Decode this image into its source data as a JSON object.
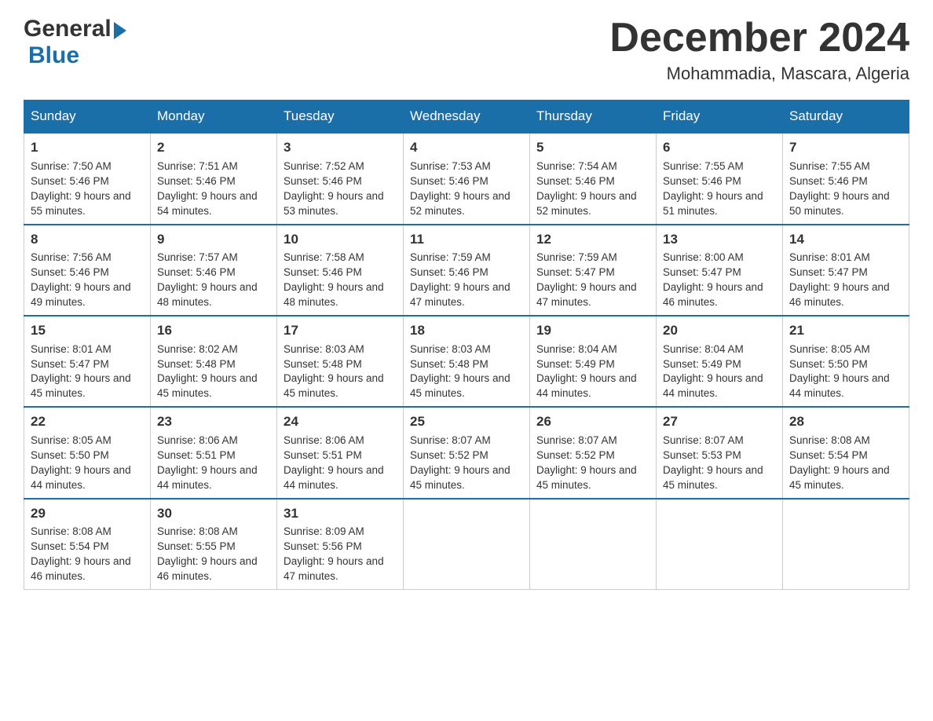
{
  "header": {
    "logo_general": "General",
    "logo_blue": "Blue",
    "month_title": "December 2024",
    "subtitle": "Mohammadia, Mascara, Algeria"
  },
  "days_of_week": [
    "Sunday",
    "Monday",
    "Tuesday",
    "Wednesday",
    "Thursday",
    "Friday",
    "Saturday"
  ],
  "weeks": [
    [
      {
        "day": "1",
        "sunrise": "Sunrise: 7:50 AM",
        "sunset": "Sunset: 5:46 PM",
        "daylight": "Daylight: 9 hours and 55 minutes."
      },
      {
        "day": "2",
        "sunrise": "Sunrise: 7:51 AM",
        "sunset": "Sunset: 5:46 PM",
        "daylight": "Daylight: 9 hours and 54 minutes."
      },
      {
        "day": "3",
        "sunrise": "Sunrise: 7:52 AM",
        "sunset": "Sunset: 5:46 PM",
        "daylight": "Daylight: 9 hours and 53 minutes."
      },
      {
        "day": "4",
        "sunrise": "Sunrise: 7:53 AM",
        "sunset": "Sunset: 5:46 PM",
        "daylight": "Daylight: 9 hours and 52 minutes."
      },
      {
        "day": "5",
        "sunrise": "Sunrise: 7:54 AM",
        "sunset": "Sunset: 5:46 PM",
        "daylight": "Daylight: 9 hours and 52 minutes."
      },
      {
        "day": "6",
        "sunrise": "Sunrise: 7:55 AM",
        "sunset": "Sunset: 5:46 PM",
        "daylight": "Daylight: 9 hours and 51 minutes."
      },
      {
        "day": "7",
        "sunrise": "Sunrise: 7:55 AM",
        "sunset": "Sunset: 5:46 PM",
        "daylight": "Daylight: 9 hours and 50 minutes."
      }
    ],
    [
      {
        "day": "8",
        "sunrise": "Sunrise: 7:56 AM",
        "sunset": "Sunset: 5:46 PM",
        "daylight": "Daylight: 9 hours and 49 minutes."
      },
      {
        "day": "9",
        "sunrise": "Sunrise: 7:57 AM",
        "sunset": "Sunset: 5:46 PM",
        "daylight": "Daylight: 9 hours and 48 minutes."
      },
      {
        "day": "10",
        "sunrise": "Sunrise: 7:58 AM",
        "sunset": "Sunset: 5:46 PM",
        "daylight": "Daylight: 9 hours and 48 minutes."
      },
      {
        "day": "11",
        "sunrise": "Sunrise: 7:59 AM",
        "sunset": "Sunset: 5:46 PM",
        "daylight": "Daylight: 9 hours and 47 minutes."
      },
      {
        "day": "12",
        "sunrise": "Sunrise: 7:59 AM",
        "sunset": "Sunset: 5:47 PM",
        "daylight": "Daylight: 9 hours and 47 minutes."
      },
      {
        "day": "13",
        "sunrise": "Sunrise: 8:00 AM",
        "sunset": "Sunset: 5:47 PM",
        "daylight": "Daylight: 9 hours and 46 minutes."
      },
      {
        "day": "14",
        "sunrise": "Sunrise: 8:01 AM",
        "sunset": "Sunset: 5:47 PM",
        "daylight": "Daylight: 9 hours and 46 minutes."
      }
    ],
    [
      {
        "day": "15",
        "sunrise": "Sunrise: 8:01 AM",
        "sunset": "Sunset: 5:47 PM",
        "daylight": "Daylight: 9 hours and 45 minutes."
      },
      {
        "day": "16",
        "sunrise": "Sunrise: 8:02 AM",
        "sunset": "Sunset: 5:48 PM",
        "daylight": "Daylight: 9 hours and 45 minutes."
      },
      {
        "day": "17",
        "sunrise": "Sunrise: 8:03 AM",
        "sunset": "Sunset: 5:48 PM",
        "daylight": "Daylight: 9 hours and 45 minutes."
      },
      {
        "day": "18",
        "sunrise": "Sunrise: 8:03 AM",
        "sunset": "Sunset: 5:48 PM",
        "daylight": "Daylight: 9 hours and 45 minutes."
      },
      {
        "day": "19",
        "sunrise": "Sunrise: 8:04 AM",
        "sunset": "Sunset: 5:49 PM",
        "daylight": "Daylight: 9 hours and 44 minutes."
      },
      {
        "day": "20",
        "sunrise": "Sunrise: 8:04 AM",
        "sunset": "Sunset: 5:49 PM",
        "daylight": "Daylight: 9 hours and 44 minutes."
      },
      {
        "day": "21",
        "sunrise": "Sunrise: 8:05 AM",
        "sunset": "Sunset: 5:50 PM",
        "daylight": "Daylight: 9 hours and 44 minutes."
      }
    ],
    [
      {
        "day": "22",
        "sunrise": "Sunrise: 8:05 AM",
        "sunset": "Sunset: 5:50 PM",
        "daylight": "Daylight: 9 hours and 44 minutes."
      },
      {
        "day": "23",
        "sunrise": "Sunrise: 8:06 AM",
        "sunset": "Sunset: 5:51 PM",
        "daylight": "Daylight: 9 hours and 44 minutes."
      },
      {
        "day": "24",
        "sunrise": "Sunrise: 8:06 AM",
        "sunset": "Sunset: 5:51 PM",
        "daylight": "Daylight: 9 hours and 44 minutes."
      },
      {
        "day": "25",
        "sunrise": "Sunrise: 8:07 AM",
        "sunset": "Sunset: 5:52 PM",
        "daylight": "Daylight: 9 hours and 45 minutes."
      },
      {
        "day": "26",
        "sunrise": "Sunrise: 8:07 AM",
        "sunset": "Sunset: 5:52 PM",
        "daylight": "Daylight: 9 hours and 45 minutes."
      },
      {
        "day": "27",
        "sunrise": "Sunrise: 8:07 AM",
        "sunset": "Sunset: 5:53 PM",
        "daylight": "Daylight: 9 hours and 45 minutes."
      },
      {
        "day": "28",
        "sunrise": "Sunrise: 8:08 AM",
        "sunset": "Sunset: 5:54 PM",
        "daylight": "Daylight: 9 hours and 45 minutes."
      }
    ],
    [
      {
        "day": "29",
        "sunrise": "Sunrise: 8:08 AM",
        "sunset": "Sunset: 5:54 PM",
        "daylight": "Daylight: 9 hours and 46 minutes."
      },
      {
        "day": "30",
        "sunrise": "Sunrise: 8:08 AM",
        "sunset": "Sunset: 5:55 PM",
        "daylight": "Daylight: 9 hours and 46 minutes."
      },
      {
        "day": "31",
        "sunrise": "Sunrise: 8:09 AM",
        "sunset": "Sunset: 5:56 PM",
        "daylight": "Daylight: 9 hours and 47 minutes."
      },
      null,
      null,
      null,
      null
    ]
  ]
}
